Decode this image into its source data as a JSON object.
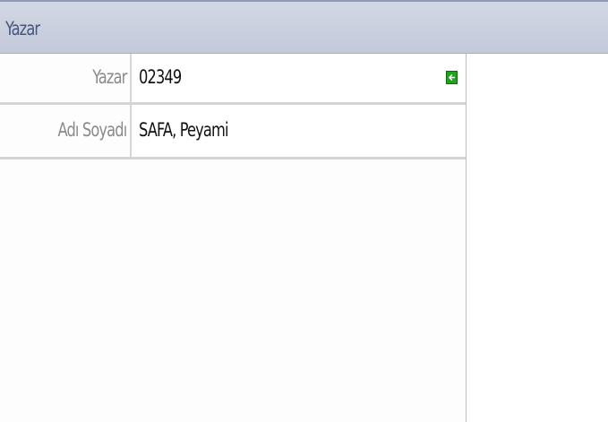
{
  "panel": {
    "title": "Yazar"
  },
  "fields": [
    {
      "label": "Yazar",
      "value": "02349",
      "action_icon": "arrow-left-icon"
    },
    {
      "label": "Adı Soyadı",
      "value": "SAFA, Peyami"
    }
  ],
  "colors": {
    "header_bg": "#c9cedd",
    "header_text": "#47567a",
    "label_text": "#8a8a8a",
    "value_text": "#111111",
    "action_button": "#1fa31f"
  }
}
